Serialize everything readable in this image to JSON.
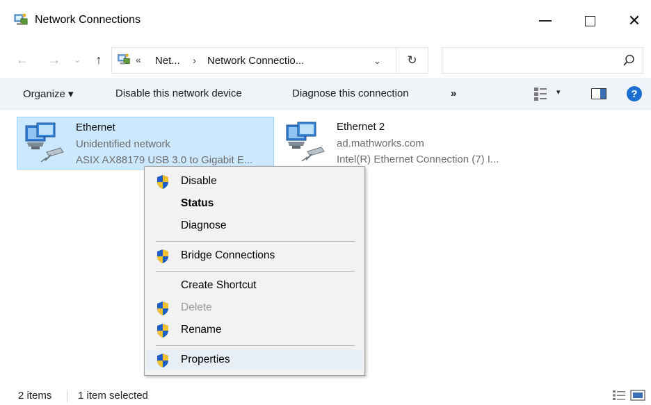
{
  "window": {
    "title": "Network Connections",
    "controls": {
      "minimize": "minimize",
      "maximize": "maximize",
      "close": "✕"
    }
  },
  "nav": {
    "back": "←",
    "forward": "→",
    "recent": "⌄",
    "up": "↑",
    "address": {
      "chevron": "«",
      "segment1": "Net...",
      "separator": "›",
      "segment2": "Network Connectio...",
      "dropdown": "⌄"
    },
    "refresh": "↻",
    "search": {
      "placeholder": ""
    }
  },
  "commandbar": {
    "organize": "Organize ▾",
    "disable_device": "Disable this network device",
    "diagnose": "Diagnose this connection",
    "more": "»",
    "view_dropdown": "▾",
    "help": "?"
  },
  "items": [
    {
      "name": "Ethernet",
      "network": "Unidentified network",
      "device": "ASIX AX88179 USB 3.0 to Gigabit E...",
      "selected": true
    },
    {
      "name": "Ethernet 2",
      "network": "ad.mathworks.com",
      "device": "Intel(R) Ethernet Connection (7) I...",
      "selected": false
    }
  ],
  "context_menu": {
    "items": [
      {
        "label": "Disable",
        "shield": true,
        "bold": false,
        "disabled": false
      },
      {
        "label": "Status",
        "shield": false,
        "bold": true,
        "disabled": false
      },
      {
        "label": "Diagnose",
        "shield": false,
        "bold": false,
        "disabled": false
      },
      {
        "label": "Bridge Connections",
        "shield": true,
        "bold": false,
        "disabled": false
      },
      {
        "label": "Create Shortcut",
        "shield": false,
        "bold": false,
        "disabled": false
      },
      {
        "label": "Delete",
        "shield": true,
        "bold": false,
        "disabled": true
      },
      {
        "label": "Rename",
        "shield": true,
        "bold": false,
        "disabled": false
      },
      {
        "label": "Properties",
        "shield": true,
        "bold": false,
        "disabled": false,
        "hover": true
      }
    ]
  },
  "status": {
    "count": "2 items",
    "selection": "1 item selected"
  },
  "colors": {
    "selection_fill": "#cce8ff",
    "selection_border": "#99d1ff",
    "commandbar_bg": "#f0f4f9",
    "help_blue": "#1a6fd0"
  }
}
